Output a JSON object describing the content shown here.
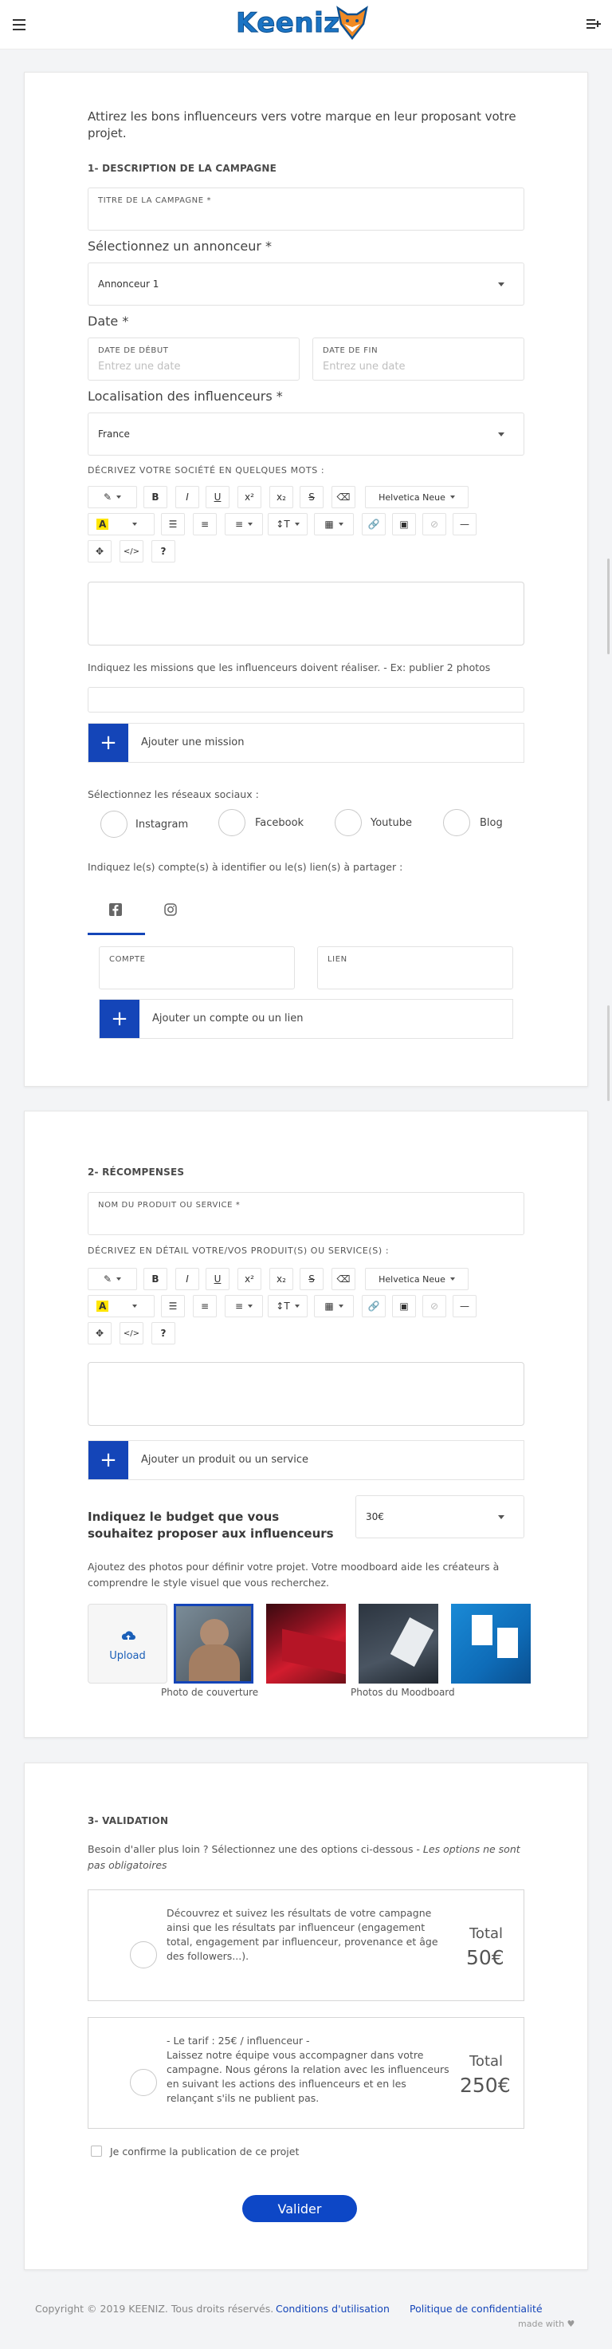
{
  "header": {
    "logo": "Keeniz"
  },
  "intro": "Attirez les bons influenceurs vers votre marque en leur proposant votre projet.",
  "section1": {
    "title": "1- DESCRIPTION DE LA CAMPAGNE",
    "campaign_title_label": "TITRE DE LA CAMPAGNE *",
    "advertiser_label": "Sélectionnez un annonceur *",
    "advertiser_value": "Annonceur 1",
    "date_label": "Date *",
    "start_label": "DATE DE DÉBUT",
    "start_placeholder": "Entrez une date",
    "end_label": "DATE DE FIN",
    "end_placeholder": "Entrez une date",
    "location_label": "Localisation des influenceurs *",
    "location_value": "France",
    "describe_label": "DÉCRIVEZ VOTRE SOCIÉTÉ EN QUELQUES MOTS :",
    "missions_hint": "Indiquez les missions que les influenceurs doivent réaliser. - Ex: publier 2 photos",
    "add_mission": "Ajouter une mission",
    "networks_hint": "Sélectionnez les réseaux sociaux :",
    "networks": [
      "Instagram",
      "Facebook",
      "Youtube",
      "Blog"
    ],
    "accounts_hint": "Indiquez le(s) compte(s) à identifier ou le(s) lien(s) à partager :",
    "account_label": "COMPTE",
    "link_label": "LIEN",
    "add_account": "Ajouter un compte ou un lien"
  },
  "toolbar": {
    "font": "Helvetica Neue",
    "bold": "B",
    "italic": "I",
    "underline": "U",
    "sup": "x²",
    "sub": "x₂",
    "strike": "S",
    "code": "</>",
    "help": "?"
  },
  "section2": {
    "title": "2- RÉCOMPENSES",
    "product_label": "NOM DU PRODUIT OU SERVICE *",
    "describe_label": "DÉCRIVEZ EN DÉTAIL VOTRE/VOS PRODUIT(S) OU SERVICE(S) :",
    "add_product": "Ajouter un produit ou un service",
    "budget_label": "Indiquez le budget que vous souhaitez proposer aux influenceurs",
    "budget_value": "30€",
    "photos_hint": "Ajoutez des photos pour définir votre projet. Votre moodboard aide les créateurs à comprendre le style visuel que vous recherchez.",
    "upload": "Upload",
    "cover_caption": "Photo de couverture",
    "moodboard_caption": "Photos du Moodboard"
  },
  "section3": {
    "title": "3- VALIDATION",
    "hint_main": "Besoin d'aller plus loin ? Sélectionnez une des options ci-dessous - ",
    "hint_em": "Les options ne sont pas obligatoires",
    "option1_text": "Découvrez et suivez les résultats de votre campagne ainsi que les résultats par influenceur (engagement total, engagement par influenceur, provenance et âge des followers...).",
    "option1_total_label": "Total",
    "option1_total": "50€",
    "option2_line1": "- Le tarif : 25€ / influenceur -",
    "option2_text": "Laissez notre équipe vous accompagner dans votre campagne. Nous gérons la relation avec les influenceurs en suivant les actions des influenceurs et en les relançant s'ils ne publient pas.",
    "option2_total_label": "Total",
    "option2_total": "250€",
    "confirm": "Je confirme la publication de ce projet",
    "submit": "Valider"
  },
  "footer": {
    "copyright": "Copyright © 2019 KEENIZ. Tous droits réservés.",
    "terms": "Conditions d'utilisation",
    "privacy": "Politique de confidentialité",
    "made_with": "made with ♥"
  },
  "colors": {
    "primary": "#1445b8",
    "logo": "#1b74c4",
    "fox": "#f08a24"
  }
}
